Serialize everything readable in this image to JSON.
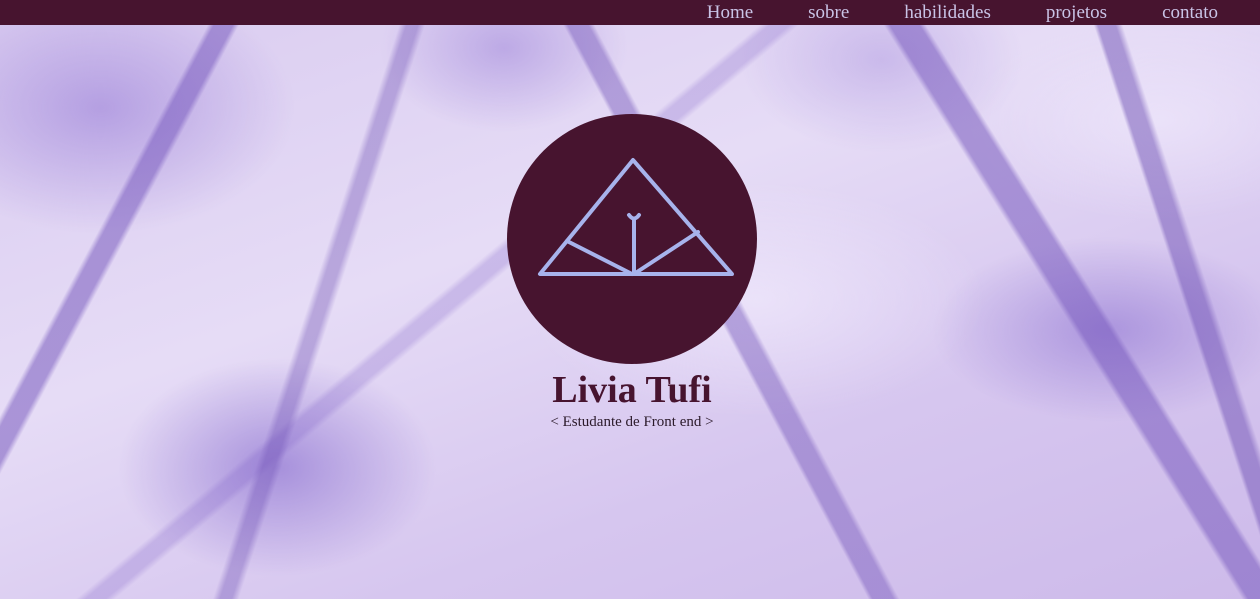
{
  "nav": {
    "items": [
      {
        "label": "Home"
      },
      {
        "label": "sobre"
      },
      {
        "label": "habilidades"
      },
      {
        "label": "projetos"
      },
      {
        "label": "contato"
      }
    ]
  },
  "hero": {
    "name": "Livia Tufi",
    "subtitle": "< Estudante de Front end >",
    "logo_icon": "triangle-monogram-icon"
  },
  "colors": {
    "navbar_bg": "#47142f",
    "nav_text": "#c9c3e6",
    "logo_circle": "#47142f",
    "logo_lines": "#a7b3ec",
    "name_text": "#47142f",
    "background": "#ddd0f3"
  }
}
